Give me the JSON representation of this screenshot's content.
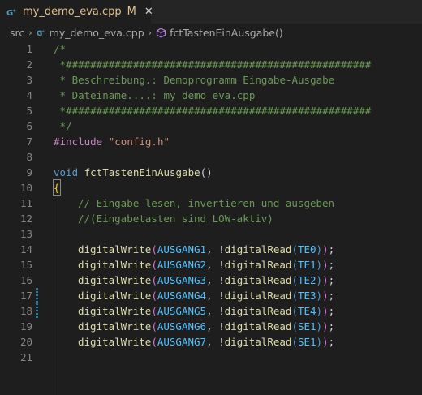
{
  "tab": {
    "filename": "my_demo_eva.cpp",
    "modified": "M",
    "close": "✕"
  },
  "breadcrumb": {
    "folder": "src",
    "file": "my_demo_eva.cpp",
    "symbol": "fctTastenEinAusgabe()"
  },
  "lines": [
    {
      "n": "1"
    },
    {
      "n": "2"
    },
    {
      "n": "3"
    },
    {
      "n": "4"
    },
    {
      "n": "5"
    },
    {
      "n": "6"
    },
    {
      "n": "7"
    },
    {
      "n": "8"
    },
    {
      "n": "9"
    },
    {
      "n": "10"
    },
    {
      "n": "11"
    },
    {
      "n": "12"
    },
    {
      "n": "13"
    },
    {
      "n": "14"
    },
    {
      "n": "15"
    },
    {
      "n": "16"
    },
    {
      "n": "17"
    },
    {
      "n": "18"
    },
    {
      "n": "19"
    },
    {
      "n": "20"
    },
    {
      "n": "21"
    }
  ],
  "code": {
    "l1": "/*",
    "l2": " *##################################################",
    "l3": " * Beschreibung.: Demoprogramm Eingabe-Ausgabe",
    "l4": " * Dateiname....: my_demo_eva.cpp",
    "l5": " *##################################################",
    "l6": " */",
    "l7_directive": "#include",
    "l7_file": "\"config.h\"",
    "l9_kw": "void",
    "l9_fn": "fctTastenEinAusgabe",
    "l9_parens": "()",
    "l10": "{",
    "l11": "// Eingabe lesen, invertieren und ausgeben",
    "l12": "//(Eingabetasten sind LOW-aktiv)",
    "writes": [
      {
        "out": "AUSGANG1",
        "in": "TE0"
      },
      {
        "out": "AUSGANG2",
        "in": "TE1"
      },
      {
        "out": "AUSGANG3",
        "in": "TE2"
      },
      {
        "out": "AUSGANG4",
        "in": "TE3"
      },
      {
        "out": "AUSGANG5",
        "in": "TE4"
      },
      {
        "out": "AUSGANG6",
        "in": "SE1"
      },
      {
        "out": "AUSGANG7",
        "in": "SE1"
      }
    ],
    "dw": "digitalWrite",
    "dr": "digitalRead"
  }
}
